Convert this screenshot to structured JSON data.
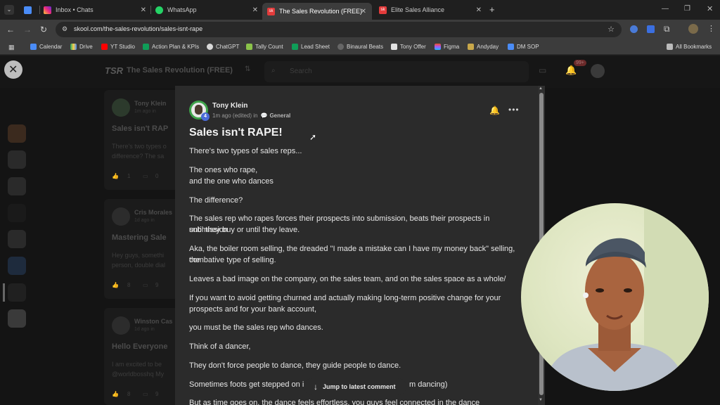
{
  "browser": {
    "tabs": [
      {
        "label": "Inbox • Chats",
        "color": "#e1306c"
      },
      {
        "label": "WhatsApp",
        "color": "#25d366"
      },
      {
        "label": "The Sales Revolution (FREE)",
        "color": "#e33b3b",
        "icon_text": "sk"
      },
      {
        "label": "Elite Sales Alliance",
        "color": "#e33b3b",
        "icon_text": "sk"
      }
    ],
    "url": "skool.com/the-sales-revolution/sales-isnt-rape",
    "bookmarks": [
      "Calendar",
      "Drive",
      "YT Studio",
      "Action Plan & KPIs",
      "ChatGPT",
      "Tally Count",
      "Lead Sheet",
      "Binaural Beats",
      "Tony Offer",
      "Figma",
      "Andyday",
      "DM SOP"
    ],
    "all_bookmarks": "All Bookmarks"
  },
  "community": {
    "logo": "TSR",
    "name": "The Sales Revolution (FREE)",
    "search_placeholder": "Search",
    "notifications": "99+"
  },
  "background_posts": [
    {
      "author": "Tony Klein",
      "meta": "1m ago in",
      "title": "Sales isn't RAP",
      "snippet": "There's two types o difference? The sa",
      "likes": "1",
      "comments": "0"
    },
    {
      "author": "Cris Morales",
      "meta": "1d ago in",
      "title": "Mastering Sale",
      "snippet": "Hey guys, somethi person, double dial",
      "likes": "8",
      "comments": "9"
    },
    {
      "author": "Winston Cas",
      "meta": "1d ago in",
      "title": "Hello Everyone",
      "snippet": "I am excited to be @worldbosshq My",
      "likes": "8",
      "comments": "9"
    }
  ],
  "post": {
    "author": "Tony Klein",
    "level": "4",
    "meta": "1m ago (edited) in",
    "category": "General",
    "title": "Sales isn't RAPE!",
    "paragraphs": [
      "There's two types of sales reps...",
      "The ones who rape,",
      "and the one who dances",
      "The difference?",
      "The sales rep who rapes forces their prospects into submission, beats their prospects in submission",
      "until they buy or until they leave.",
      "Aka, the boiler room selling, the dreaded \"I made a mistake can I have my money back\" selling, the",
      "combative type of selling.",
      "Leaves a bad image on the company, on the sales team, and on the sales space as a whole/",
      "If you want to avoid getting churned and actually making long-term positive change for your",
      "prospects and for your bank account,",
      "you must be the sales rep who dances.",
      "Think of a dancer,",
      "They don't force people to dance, they guide people to dance.",
      "Sometimes foots get stepped on i",
      "m dancing)",
      "But as time goes on, the dance feels effortless, you guys feel connected in the dance"
    ],
    "jump_label": "Jump to latest comment"
  },
  "colors": {
    "accent": "#4a8cf7",
    "bell": "#f2c12e",
    "avatar_green": "#3ea34a"
  }
}
